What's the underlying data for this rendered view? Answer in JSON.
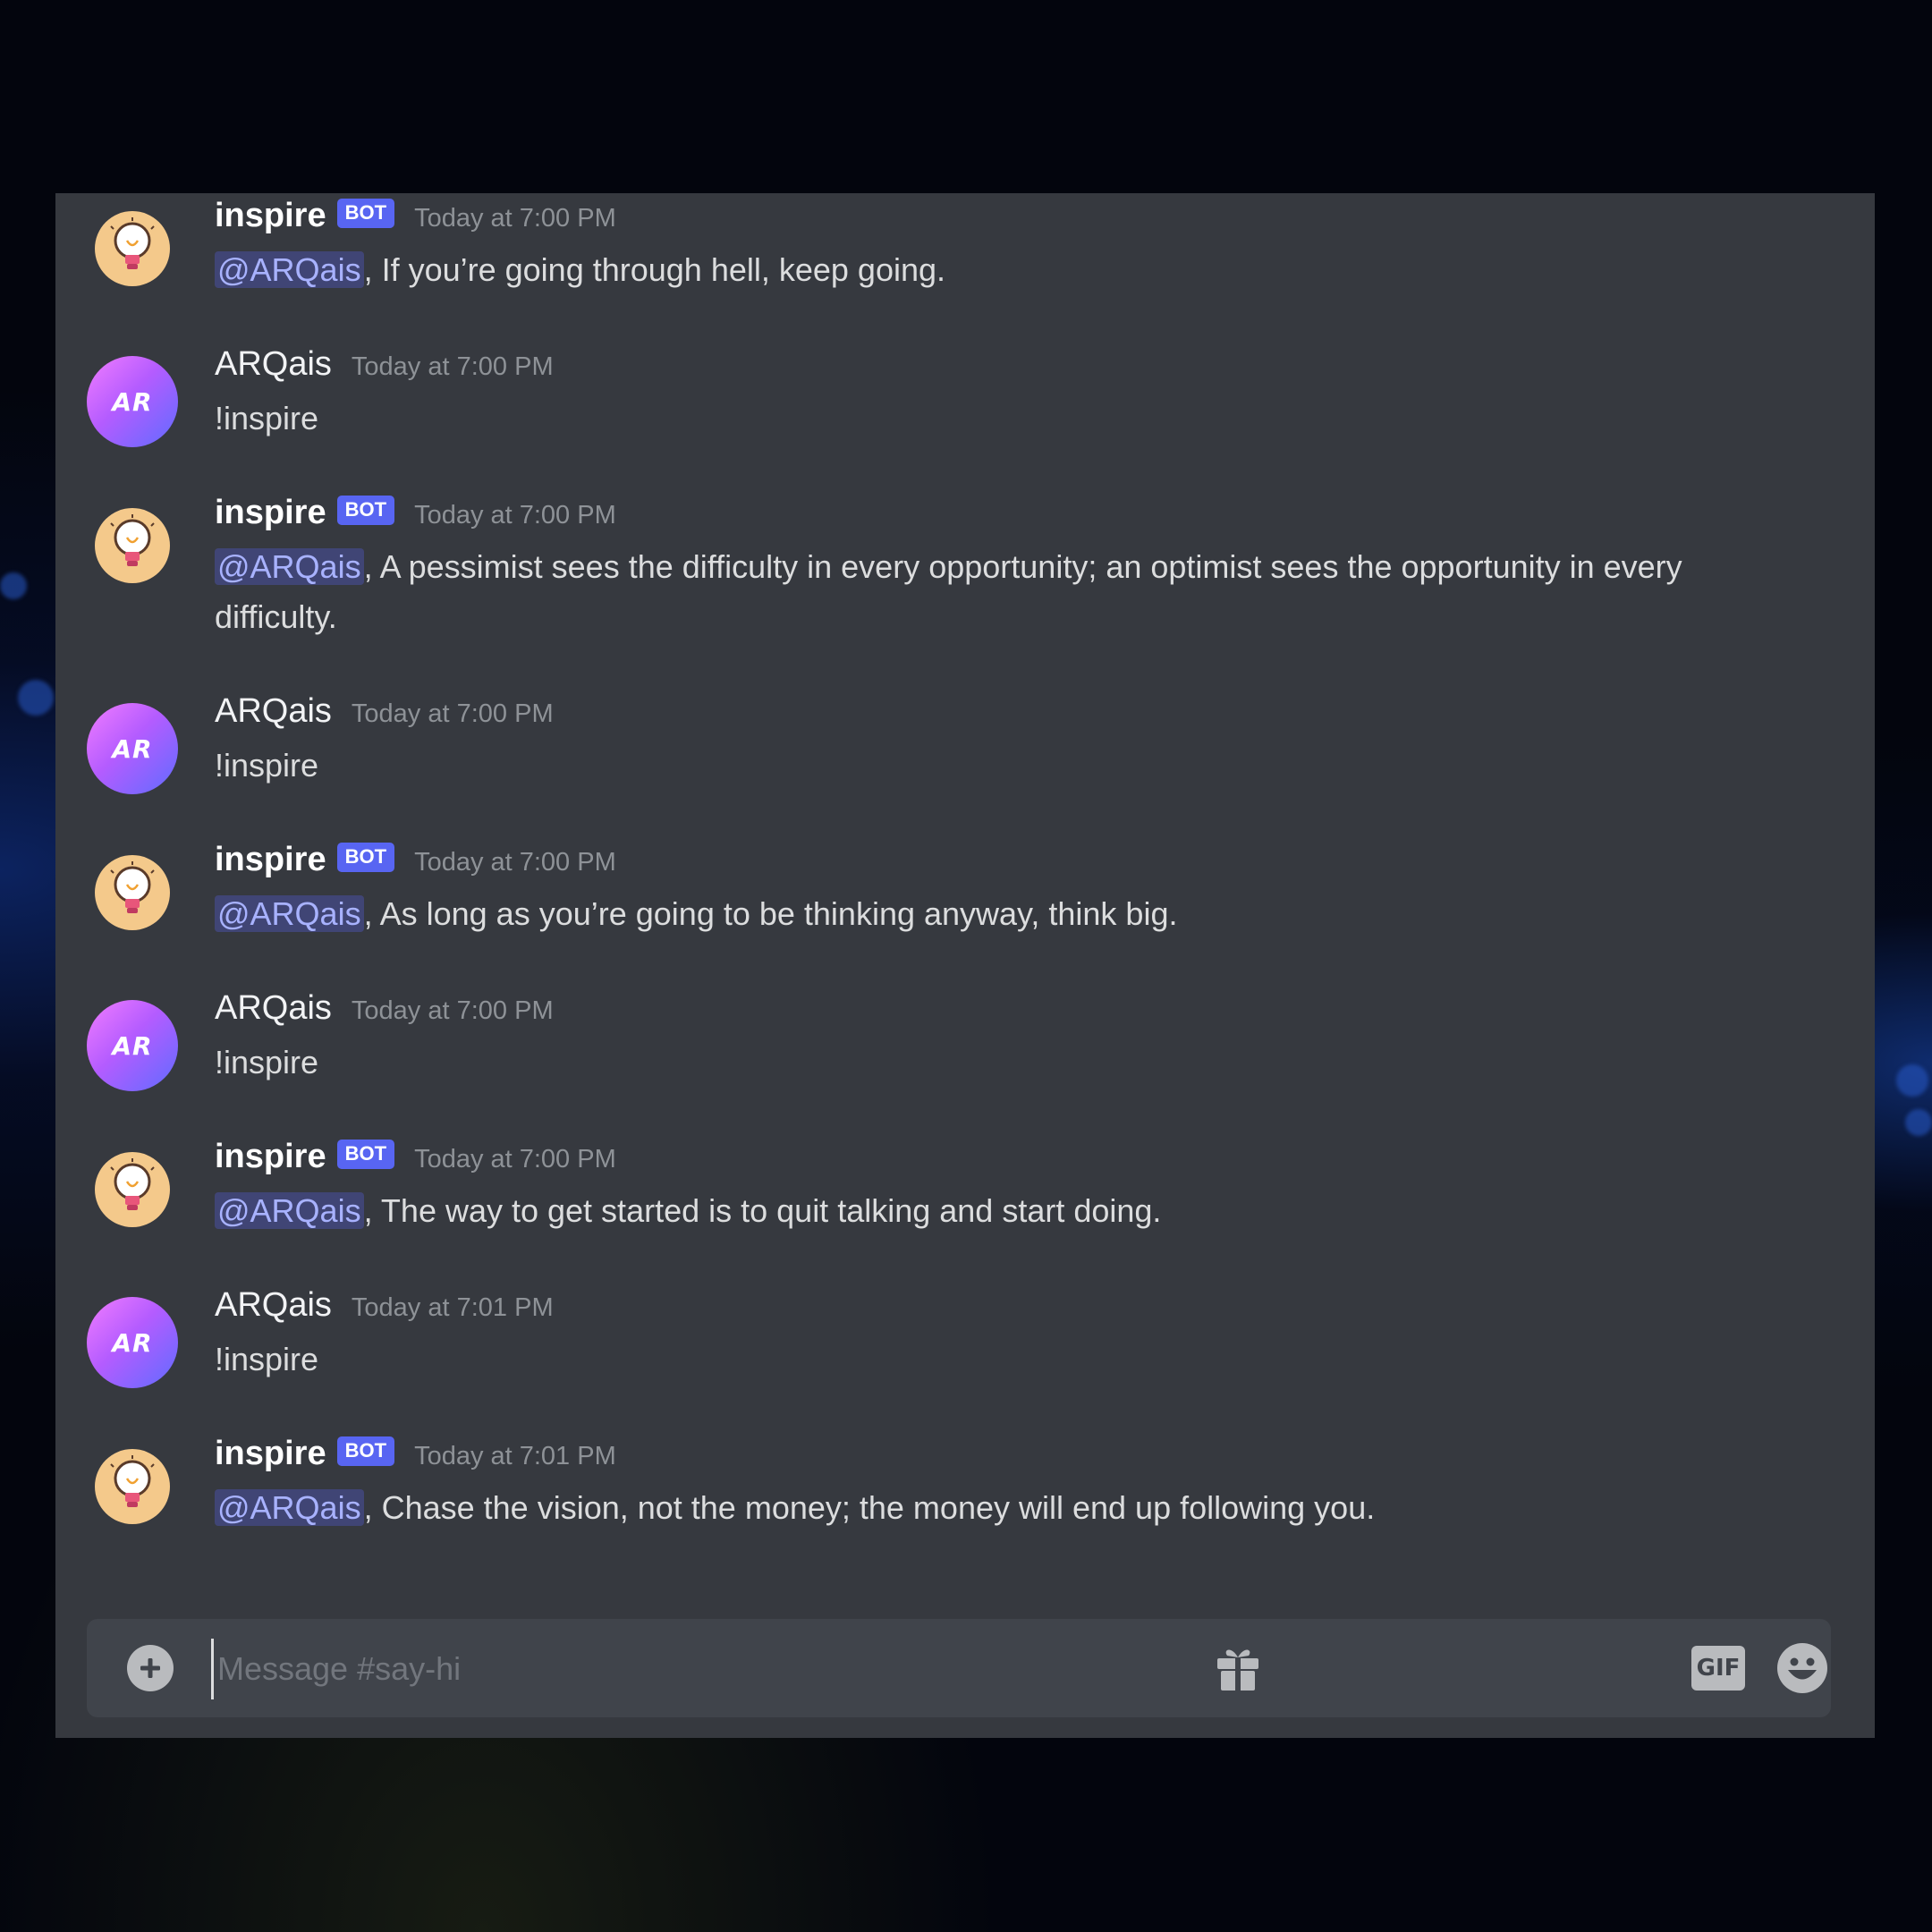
{
  "channel": {
    "composer_placeholder": "Message #say-hi"
  },
  "colors": {
    "background": "#36393f",
    "bot_tag": "#5865f2",
    "mention": "#a8b2ff",
    "composer": "#40444b"
  },
  "messages": [
    {
      "author": "inspire",
      "is_bot": true,
      "bot_tag": "BOT",
      "timestamp": "Today at 7:00 PM",
      "mention": "@ARQais",
      "text": ", If you’re going through hell, keep going."
    },
    {
      "author": "ARQais",
      "is_bot": false,
      "timestamp": "Today at 7:00 PM",
      "text": "!inspire"
    },
    {
      "author": "inspire",
      "is_bot": true,
      "bot_tag": "BOT",
      "timestamp": "Today at 7:00 PM",
      "mention": "@ARQais",
      "text": ", A pessimist sees the difficulty in every opportunity; an optimist sees the opportunity in every difficulty."
    },
    {
      "author": "ARQais",
      "is_bot": false,
      "timestamp": "Today at 7:00 PM",
      "text": "!inspire"
    },
    {
      "author": "inspire",
      "is_bot": true,
      "bot_tag": "BOT",
      "timestamp": "Today at 7:00 PM",
      "mention": "@ARQais",
      "text": ", As long as you’re going to be thinking anyway, think big."
    },
    {
      "author": "ARQais",
      "is_bot": false,
      "timestamp": "Today at 7:00 PM",
      "text": "!inspire"
    },
    {
      "author": "inspire",
      "is_bot": true,
      "bot_tag": "BOT",
      "timestamp": "Today at 7:00 PM",
      "mention": "@ARQais",
      "text": ", The way to get started is to quit talking and start doing."
    },
    {
      "author": "ARQais",
      "is_bot": false,
      "timestamp": "Today at 7:01 PM",
      "text": "!inspire"
    },
    {
      "author": "inspire",
      "is_bot": true,
      "bot_tag": "BOT",
      "timestamp": "Today at 7:01 PM",
      "mention": "@ARQais",
      "text": ", Chase the vision, not the money; the money will end up following you."
    }
  ],
  "avatars": {
    "bot_icon": "lightbulb-icon",
    "user_logo_text": "AR"
  },
  "composer_icons": [
    "add-attachment-icon",
    "gift-icon",
    "gif-icon",
    "emoji-icon"
  ],
  "gif_label": "GIF"
}
